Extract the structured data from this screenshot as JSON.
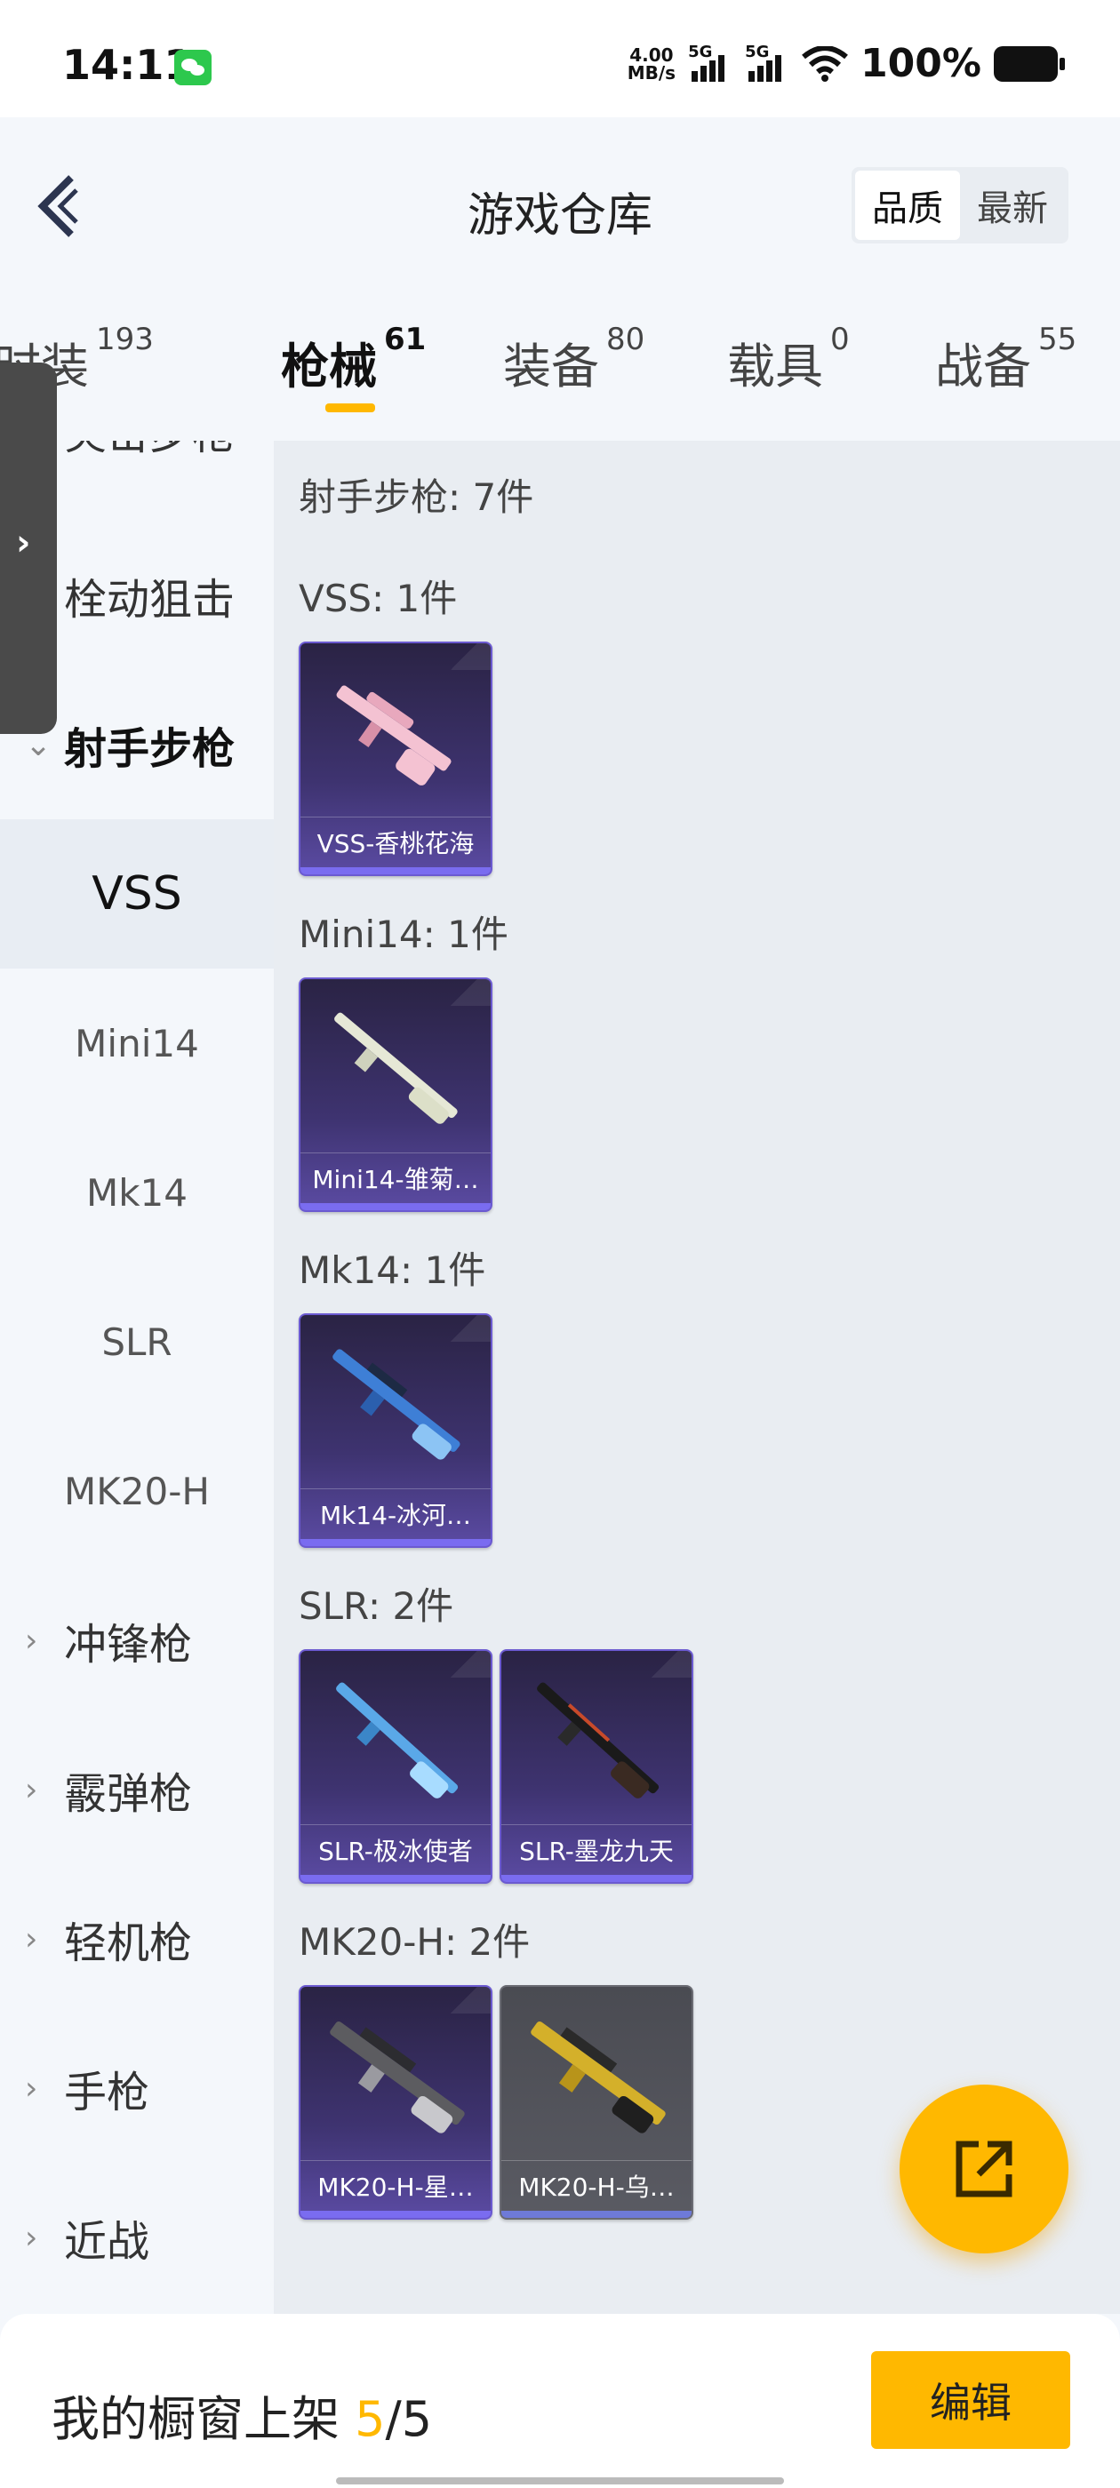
{
  "status_bar": {
    "time": "14:11",
    "net_speed_value": "4.00",
    "net_speed_unit": "MB/s",
    "signal1_label": "5G",
    "signal2_label": "5G",
    "battery_percent": "100%"
  },
  "header": {
    "title": "游戏仓库",
    "sort_options": [
      "品质",
      "最新"
    ],
    "active_sort": "品质"
  },
  "tabs": [
    {
      "label": "时装",
      "count": "193"
    },
    {
      "label": "枪械",
      "count": "61"
    },
    {
      "label": "装备",
      "count": "80"
    },
    {
      "label": "载具",
      "count": "0"
    },
    {
      "label": "战备",
      "count": "55"
    }
  ],
  "sidebar": {
    "partial_top": "突击步枪",
    "items": [
      {
        "label": "栓动狙击",
        "type": "category"
      },
      {
        "label": "射手步枪",
        "type": "category",
        "expanded": true
      },
      {
        "label": "VSS",
        "type": "sub",
        "selected": true
      },
      {
        "label": "Mini14",
        "type": "sub"
      },
      {
        "label": "Mk14",
        "type": "sub"
      },
      {
        "label": "SLR",
        "type": "sub"
      },
      {
        "label": "MK20-H",
        "type": "sub"
      },
      {
        "label": "冲锋枪",
        "type": "category"
      },
      {
        "label": "霰弹枪",
        "type": "category"
      },
      {
        "label": "轻机枪",
        "type": "category"
      },
      {
        "label": "手枪",
        "type": "category"
      },
      {
        "label": "近战",
        "type": "category"
      }
    ]
  },
  "content": {
    "summary": "射手步枪: 7件",
    "sections": [
      {
        "title": "VSS: 1件",
        "items": [
          {
            "name": "VSS-香桃花海",
            "icon": "pink-vss-rifle-icon"
          }
        ]
      },
      {
        "title": "Mini14: 1件",
        "items": [
          {
            "name": "Mini14-雏菊…",
            "icon": "white-mini14-rifle-icon"
          }
        ]
      },
      {
        "title": "Mk14: 1件",
        "items": [
          {
            "name": "Mk14-冰河…",
            "icon": "blue-mk14-rifle-icon"
          }
        ]
      },
      {
        "title": "SLR: 2件",
        "items": [
          {
            "name": "SLR-极冰使者",
            "icon": "ice-slr-rifle-icon"
          },
          {
            "name": "SLR-墨龙九天",
            "icon": "dark-slr-rifle-icon"
          }
        ]
      },
      {
        "title": "MK20-H: 2件",
        "items": [
          {
            "name": "MK20-H-星…",
            "icon": "silver-mk20-rifle-icon"
          },
          {
            "name": "MK20-H-乌…",
            "icon": "gold-mk20-rifle-icon"
          }
        ]
      }
    ]
  },
  "bottom_bar": {
    "label": "我的橱窗上架",
    "current": "5",
    "separator": "/",
    "total": "5",
    "edit_label": "编辑"
  },
  "colors": {
    "accent": "#ffb800",
    "card_purple": "#3e3370",
    "card_gray": "#5a5b63"
  }
}
